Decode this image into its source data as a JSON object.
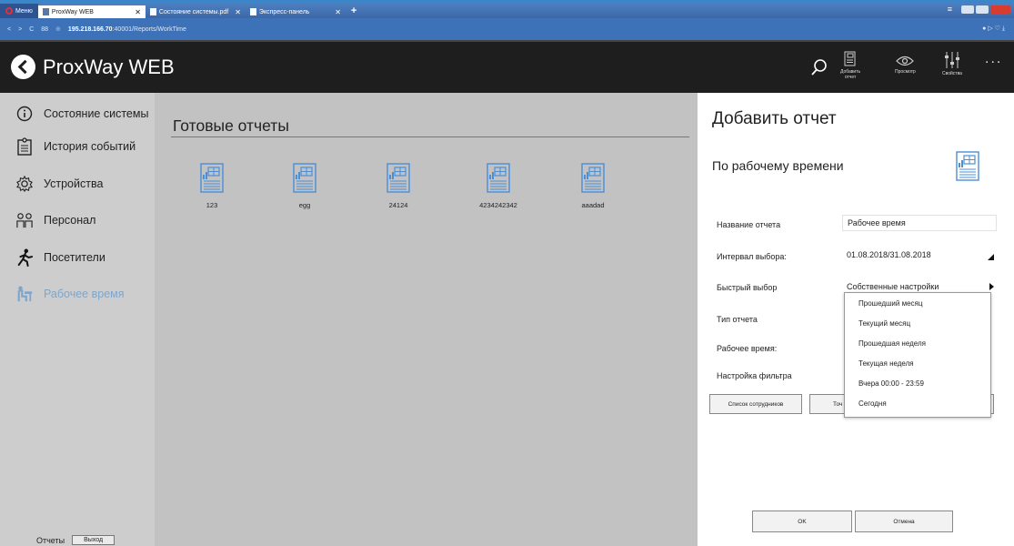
{
  "browser": {
    "menu_label": "Меню",
    "tabs": [
      {
        "label": "ProxWay WEB"
      },
      {
        "label": "Состояние системы.pdf"
      },
      {
        "label": "Экспресс-панель"
      }
    ],
    "new_tab": "+",
    "address_host": "195.218.166.70",
    "address_path": ":40001/Reports/WorkTime",
    "nav_back": "<",
    "nav_forward": ">",
    "reload": "C",
    "grid": "88"
  },
  "header": {
    "app_name": "ProxWay WEB",
    "toolbar": {
      "add_report_line1": "Добавить",
      "add_report_line2": "отчет",
      "preview": "Просмотр",
      "properties": "Свойства",
      "more": "..."
    }
  },
  "sidebar": {
    "items": [
      {
        "label": "Состояние системы",
        "icon": "info-icon"
      },
      {
        "label": "История событий",
        "icon": "history-icon"
      },
      {
        "label": "Устройства",
        "icon": "gear-icon"
      },
      {
        "label": "Персонал",
        "icon": "staff-icon"
      },
      {
        "label": "Посетители",
        "icon": "visitor-icon"
      },
      {
        "label": "Рабочее время",
        "icon": "worktime-icon",
        "active": true
      }
    ],
    "footer": {
      "reports": "Отчеты",
      "logout": "Выход"
    }
  },
  "main": {
    "title": "Готовые отчеты",
    "reports": [
      {
        "label": "123"
      },
      {
        "label": "egg"
      },
      {
        "label": "24124"
      },
      {
        "label": "4234242342"
      },
      {
        "label": "aaadad"
      }
    ]
  },
  "panel": {
    "title": "Добавить отчет",
    "subtitle": "По рабочему времени",
    "fields": {
      "name_label": "Название отчета",
      "name_value": "Рабочее время",
      "interval_label": "Интервал выбора:",
      "interval_value": "01.08.2018/31.08.2018",
      "quick_label": "Быстрый выбор",
      "quick_value": "Собственные настройки",
      "type_label": "Тип отчета",
      "worktime_label": "Рабочее время:",
      "filter_label": "Настройка фильтра"
    },
    "buttons": {
      "employees": "Список сотрудников",
      "points_partial": "Точ",
      "ok": "OK",
      "cancel": "Отмена"
    },
    "dropdown_options": [
      "Прошедший месяц",
      "Текущий месяц",
      "Прошедшая неделя",
      "Текущая неделя",
      "Вчера 00:00 - 23:59",
      "Сегодня"
    ]
  },
  "colors": {
    "header_bg": "#1e1e1e",
    "sidebar_bg": "#cdcdcd",
    "main_bg": "#c2c2c2",
    "active_item": "#7ea6cc",
    "report_icon": "#4a8fd8"
  }
}
